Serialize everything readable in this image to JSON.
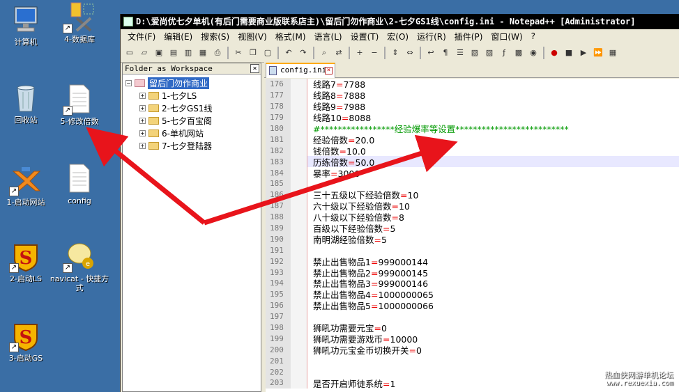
{
  "desktop": {
    "icons": [
      {
        "label": "计算机",
        "icon": "computer-icon"
      },
      {
        "label": "4-数据库",
        "icon": "database-tools-icon"
      },
      {
        "label": "回收站",
        "icon": "recycle-bin-icon"
      },
      {
        "label": "5-修改倍数",
        "icon": "document-shortcut-icon"
      },
      {
        "label": "1-启动网站",
        "icon": "xampp-icon"
      },
      {
        "label": "config",
        "icon": "document-icon"
      },
      {
        "label": "2-启动LS",
        "icon": "s-shield-icon"
      },
      {
        "label": "navicat - 快捷方式",
        "icon": "navicat-icon"
      },
      {
        "label": "3-启动GS",
        "icon": "s-shield-icon"
      }
    ]
  },
  "window": {
    "title": "D:\\爱尚优七夕单机(有后门需要商业版联系店主)\\留后门勿作商业\\2-七夕GS1线\\config.ini - Notepad++ [Administrator]"
  },
  "menu": [
    "文件(F)",
    "编辑(E)",
    "搜索(S)",
    "视图(V)",
    "格式(M)",
    "语言(L)",
    "设置(T)",
    "宏(O)",
    "运行(R)",
    "插件(P)",
    "窗口(W)",
    "?"
  ],
  "folder_panel": {
    "title": "Folder as Workspace",
    "root": "留后门勿作商业",
    "children": [
      "1-七夕LS",
      "2-七夕GS1线",
      "5-七夕百宝阁",
      "6-单机网站",
      "7-七夕登陆器"
    ]
  },
  "tab": {
    "label": "config.ini"
  },
  "editor": {
    "lines": [
      {
        "n": "176",
        "key": "线路7",
        "val": "7788"
      },
      {
        "n": "177",
        "key": "线路8",
        "val": "7888"
      },
      {
        "n": "178",
        "key": "线路9",
        "val": "7988"
      },
      {
        "n": "179",
        "key": "线路10",
        "val": "8088"
      },
      {
        "n": "180",
        "comment": "#*****************经验爆率等设置**************************"
      },
      {
        "n": "181",
        "key": "经验倍数",
        "val": "20.0"
      },
      {
        "n": "182",
        "key": "钱倍数",
        "val": "10.0"
      },
      {
        "n": "183",
        "key": "历练倍数",
        "val": "50.0"
      },
      {
        "n": "184",
        "key": "暴率",
        "val": "3000"
      },
      {
        "n": "185"
      },
      {
        "n": "186",
        "key": "三十五级以下经验倍数",
        "val": "10"
      },
      {
        "n": "187",
        "key": "六十级以下经验倍数",
        "val": "10"
      },
      {
        "n": "188",
        "key": "八十级以下经验倍数",
        "val": "8"
      },
      {
        "n": "189",
        "key": "百级以下经验倍数",
        "val": "5"
      },
      {
        "n": "190",
        "key": "南明湖经验倍数",
        "val": "5"
      },
      {
        "n": "191"
      },
      {
        "n": "192",
        "key": "禁止出售物品1",
        "val": "999000144"
      },
      {
        "n": "193",
        "key": "禁止出售物品2",
        "val": "999000145"
      },
      {
        "n": "194",
        "key": "禁止出售物品3",
        "val": "999000146"
      },
      {
        "n": "195",
        "key": "禁止出售物品4",
        "val": "1000000065"
      },
      {
        "n": "196",
        "key": "禁止出售物品5",
        "val": "1000000066"
      },
      {
        "n": "197"
      },
      {
        "n": "198",
        "key": "狮吼功需要元宝",
        "val": "0"
      },
      {
        "n": "199",
        "key": "狮吼功需要游戏币",
        "val": "10000"
      },
      {
        "n": "200",
        "key": "狮吼功元宝金币切换开关",
        "val": "0"
      },
      {
        "n": "201"
      },
      {
        "n": "202"
      },
      {
        "n": "203",
        "key": "是否开启师徒系统",
        "val": "1"
      }
    ],
    "current_line": "183"
  },
  "watermark": {
    "line1": "热血侠网游单机论坛",
    "line2": "www.rexuexia.com"
  },
  "colors": {
    "desktop": "#3a6ea5",
    "arrow": "#e8141b",
    "comment": "#009900",
    "equals": "#ee0000"
  }
}
